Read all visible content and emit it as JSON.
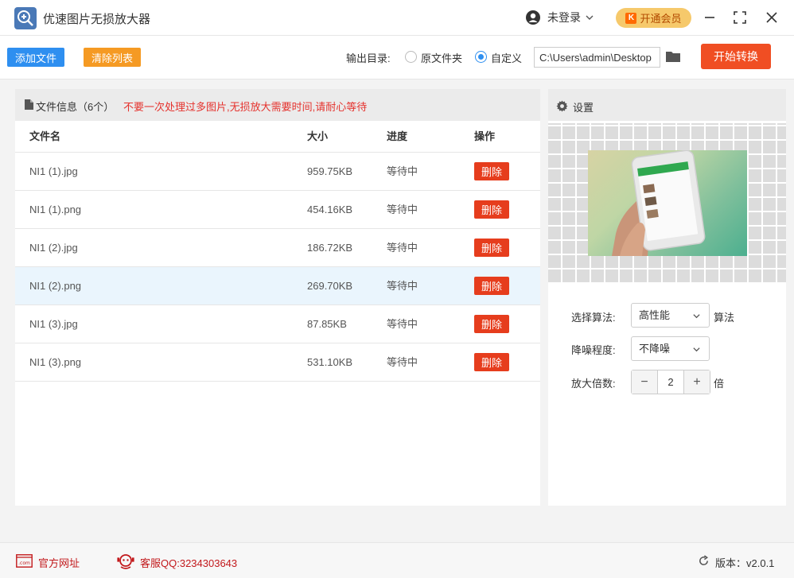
{
  "app": {
    "title": "优速图片无损放大器"
  },
  "user": {
    "name": "未登录",
    "vip_label": "开通会员",
    "vip_badge": "K"
  },
  "toolbar": {
    "add_label": "添加文件",
    "clear_label": "清除列表",
    "output_label": "输出目录:",
    "option_original": "原文件夹",
    "option_custom": "自定义",
    "path_value": "C:\\Users\\admin\\Desktop",
    "start_label": "开始转换"
  },
  "files": {
    "info_label": "文件信息（6个）",
    "warning": "不要一次处理过多图片,无损放大需要时间,请耐心等待",
    "headers": {
      "name": "文件名",
      "size": "大小",
      "progress": "进度",
      "action": "操作"
    },
    "rows": [
      {
        "name": "NI1 (1).jpg",
        "size": "959.75KB",
        "status": "等待中",
        "action": "删除"
      },
      {
        "name": "NI1 (1).png",
        "size": "454.16KB",
        "status": "等待中",
        "action": "删除"
      },
      {
        "name": "NI1 (2).jpg",
        "size": "186.72KB",
        "status": "等待中",
        "action": "删除"
      },
      {
        "name": "NI1 (2).png",
        "size": "269.70KB",
        "status": "等待中",
        "action": "删除"
      },
      {
        "name": "NI1 (3).jpg",
        "size": "87.85KB",
        "status": "等待中",
        "action": "删除"
      },
      {
        "name": "NI1 (3).png",
        "size": "531.10KB",
        "status": "等待中",
        "action": "删除"
      }
    ]
  },
  "settings": {
    "title": "设置",
    "algorithm_label": "选择算法:",
    "algorithm_value": "高性能",
    "algorithm_suffix": "算法",
    "denoise_label": "降噪程度:",
    "denoise_value": "不降噪",
    "scale_label": "放大倍数:",
    "scale_value": "2",
    "scale_suffix": "倍",
    "minus": "−",
    "plus": "+"
  },
  "footer": {
    "website": "官方网址",
    "qq": "客服QQ:3234303643",
    "version": "版本：v2.0.1"
  },
  "colors": {
    "primary": "#2e8ff0",
    "danger": "#f04e23",
    "warn": "#f59a23"
  }
}
